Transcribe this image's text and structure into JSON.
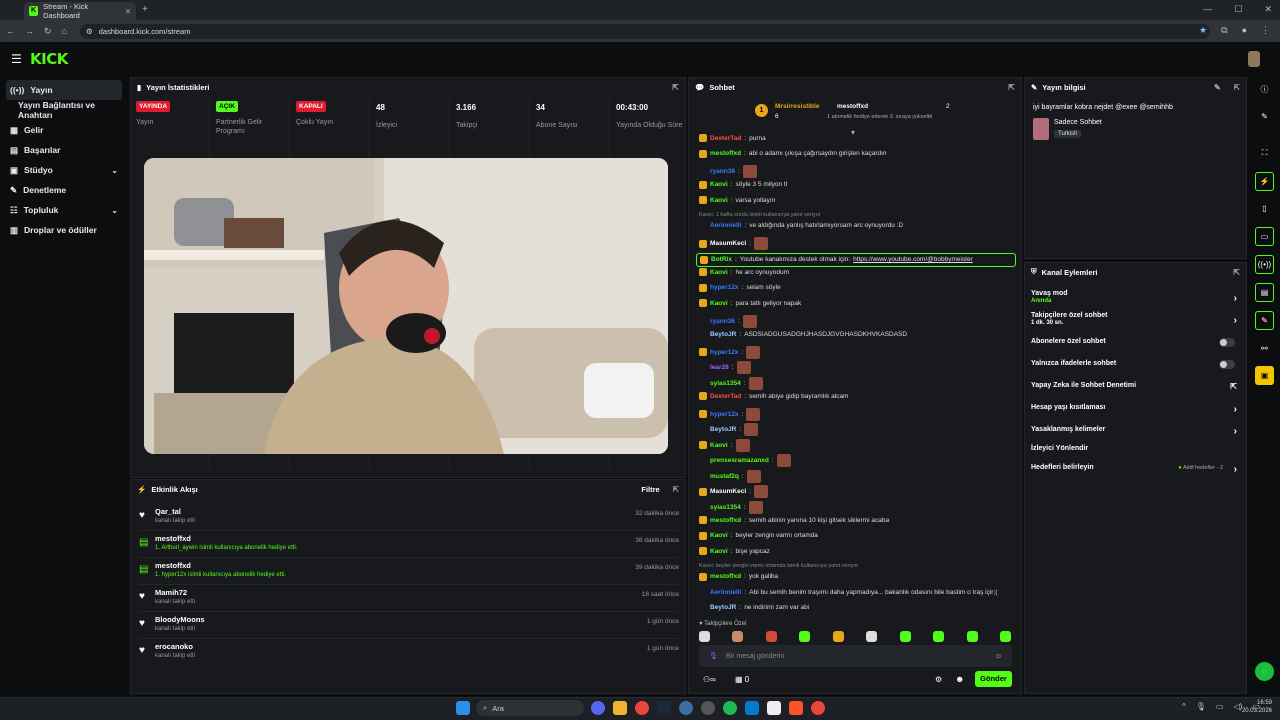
{
  "browser": {
    "tab_title": "Stream - Kick Dashboard",
    "url": "dashboard.kick.com/stream"
  },
  "header": {
    "logo": "KICK"
  },
  "sidebar": {
    "items": [
      {
        "label": "Yayın",
        "icon": "broadcast-icon"
      },
      {
        "label": "Yayın Bağlantısı ve Anahtarı",
        "icon": "none"
      },
      {
        "label": "Gelir",
        "icon": "money-icon"
      },
      {
        "label": "Başarılar",
        "icon": "trophy-icon"
      },
      {
        "label": "Stüdyo",
        "icon": "studio-icon"
      },
      {
        "label": "Denetleme",
        "icon": "wrench-icon"
      },
      {
        "label": "Topluluk",
        "icon": "people-icon"
      },
      {
        "label": "Droplar ve ödüller",
        "icon": "gift-icon"
      }
    ]
  },
  "stats": {
    "title": "Yayın İstatistikleri",
    "cols": [
      {
        "value": "YAYINDA",
        "label": "Yayın",
        "badge": "red"
      },
      {
        "value": "AÇIK",
        "label": "Partnerlik Gelir Programı",
        "badge": "green"
      },
      {
        "value": "KAPALI",
        "label": "Çoklu Yayın",
        "badge": "red"
      },
      {
        "value": "48",
        "label": "İzleyici"
      },
      {
        "value": "3.166",
        "label": "Takipçi"
      },
      {
        "value": "34",
        "label": "Abone Sayısı"
      },
      {
        "value": "00:43:00",
        "label": "Yayında Olduğu Süre"
      }
    ]
  },
  "activity": {
    "title": "Etkinlik Akışı",
    "filter": "Filtre",
    "rows": [
      {
        "name": "Qar_tal",
        "sub": "kanalı takip etti",
        "time": "32 dakika önce",
        "type": "follow"
      },
      {
        "name": "mestoffxd",
        "sub": "1. Arthurl_aywin isimli kullanıcıya abonelik hediye etti.",
        "time": "38 dakika önce",
        "type": "gift"
      },
      {
        "name": "mestoffxd",
        "sub": "1. hyper12x isimli kullanıcıya abonelik hediye etti.",
        "time": "39 dakika önce",
        "type": "gift"
      },
      {
        "name": "Mamih72",
        "sub": "kanalı takip etti",
        "time": "18 saat önce",
        "type": "follow"
      },
      {
        "name": "BloodyMoons",
        "sub": "kanalı takip etti",
        "time": "1 gün önce",
        "type": "follow"
      },
      {
        "name": "erocanoko",
        "sub": "kanalı takip etti",
        "time": "1 gün önce",
        "type": "follow"
      }
    ]
  },
  "chat": {
    "title": "Sohbet",
    "pinned": {
      "left_name": "Mrsirresistible",
      "left_count": "6",
      "right_name": "mestoffxd",
      "right_count": "2",
      "desc": "1 abonelik hediye ederek 3. sıraya yükseltti"
    },
    "messages": [
      {
        "user": "DexterTad",
        "text": "purna",
        "color": "#ff4d4d"
      },
      {
        "user": "mestoffxd",
        "text": "abi o adamı çıkışa çağırsaydın girişten kaçardın",
        "color": "#53fc18"
      },
      {
        "user": "ryann36",
        "text": "",
        "color": "#3a7bff",
        "emote": true
      },
      {
        "user": "Kaovi",
        "text": "söyle 3 5 milyon tl",
        "color": "#53fc18"
      },
      {
        "user": "Kaovi",
        "text": "varsa yollayın",
        "color": "#53fc18"
      },
      {
        "reply": "Kaovi: 1 hafta sürdü isimli kullanıcıya yanıt veriyor"
      },
      {
        "user": "Aerinnielli",
        "text": "ve aldığında yanlış hatırlamıyorsam arc oynuyordu :D",
        "color": "#3a7bff"
      },
      {
        "user": "MasumKeci",
        "text": "",
        "color": "#fff",
        "emote": true
      },
      {
        "user": "BotRix",
        "text": "Youtube kanalımıza destek olmak için:",
        "link": "https://www.youtube.com/@bobbymeister",
        "color": "#53fc18"
      },
      {
        "user": "Kaovi",
        "text": "he arc oynuyodum",
        "color": "#53fc18"
      },
      {
        "user": "hyper12x",
        "text": "selam söyle",
        "color": "#3a7bff"
      },
      {
        "user": "Kaovi",
        "text": "para tatlı geliyor napak",
        "color": "#53fc18"
      },
      {
        "user": "ryann36",
        "text": "",
        "color": "#3a7bff",
        "emote": true
      },
      {
        "user": "BeytoJR",
        "text": "ASDSIADGUSADGHJHASDJGVGHASDKHVKASDASD",
        "color": "#9ecbff"
      },
      {
        "user": "hyper12x",
        "text": "",
        "color": "#3a7bff",
        "emote": true
      },
      {
        "user": "lear28",
        "text": "",
        "color": "#a35cff",
        "emote": true
      },
      {
        "user": "syias1354",
        "text": "",
        "color": "#53fc18",
        "emote": true
      },
      {
        "user": "DexterTad",
        "text": "semih abiye gidip bayramlık alcam",
        "color": "#ff4d4d"
      },
      {
        "user": "hyper12x",
        "text": "",
        "color": "#3a7bff",
        "emote": true
      },
      {
        "user": "BeytoJR",
        "text": "",
        "color": "#9ecbff",
        "emote": true
      },
      {
        "user": "Kaovi",
        "text": "",
        "color": "#53fc18",
        "emote": true
      },
      {
        "user": "prensesramazanxd",
        "text": "",
        "color": "#53fc18",
        "emote": true
      },
      {
        "user": "mustaf2q",
        "text": "",
        "color": "#53fc18",
        "emote": true
      },
      {
        "user": "MasumKeci",
        "text": "",
        "color": "#fff",
        "emote": true
      },
      {
        "user": "syias1354",
        "text": "",
        "color": "#53fc18",
        "emote": true
      },
      {
        "user": "mestoffxd",
        "text": "semih abinin yanına 10 kişi gitsek siklermi acaba",
        "color": "#53fc18"
      },
      {
        "user": "Kaovi",
        "text": "beyler zengin varmı ortamda",
        "color": "#53fc18"
      },
      {
        "user": "Kaovi",
        "text": "bişe yapcaz",
        "color": "#53fc18"
      },
      {
        "reply": "Kaovi: beyler zengin varmı ortamda isimli kullanıcıya yanıt veriyor"
      },
      {
        "user": "mestoffxd",
        "text": "yok galiba",
        "color": "#53fc18"
      },
      {
        "user": "Aerinnielli",
        "text": "Abi bu semih benim traşımı daha yapmadıya... bakanlık odasını bile bastim o traş içir;(",
        "color": "#3a7bff"
      },
      {
        "user": "BeytoJR",
        "text": "ne indirimi zam var abi",
        "color": "#9ecbff"
      }
    ],
    "followers_only": "Takipçilere Özel",
    "input_placeholder": "Bir mesaj gönderin",
    "points": "0",
    "send": "Gönder"
  },
  "info": {
    "title": "Yayın bilgisi",
    "stream_title": "iyi bayramlar kobra nejdet @exee @semihhb",
    "category": "Sadece Sohbet",
    "language": "Turkish"
  },
  "actions": {
    "title": "Kanal Eylemleri",
    "items": [
      {
        "label": "Yavaş mod",
        "sub": "Anında",
        "ctl": "arrow"
      },
      {
        "label": "Takipçilere özel sohbet",
        "sub": "1 dk. 30 sn.",
        "ctl": "arrow"
      },
      {
        "label": "Abonelere özel sohbet",
        "ctl": "toggle"
      },
      {
        "label": "Yalnızca ifadelerle sohbet",
        "ctl": "toggle"
      },
      {
        "label": "Yapay Zeka ile Sohbet Denetimi",
        "ctl": "pop"
      },
      {
        "label": "Hesap yaşı kısıtlaması",
        "ctl": "arrow"
      },
      {
        "label": "Yasaklanmış kelimeler",
        "ctl": "arrow"
      },
      {
        "label": "İzleyici Yönlendir",
        "ctl": "none"
      },
      {
        "label": "Hedefleri belirleyin",
        "ctl": "arrow",
        "extra": "Aktif hedefler - 2"
      }
    ]
  },
  "taskbar": {
    "search": "Ara",
    "time": "16:59",
    "date": "20.03.2026"
  }
}
